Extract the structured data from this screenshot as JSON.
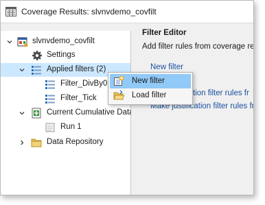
{
  "window": {
    "title": "Coverage Results: slvnvdemo_covfilt"
  },
  "tree": {
    "items": [
      {
        "label": "slvnvdemo_covfilt",
        "icon": "model-icon",
        "expanded": true
      },
      {
        "label": "Settings",
        "icon": "gear-icon"
      },
      {
        "label": "Applied filters (2)",
        "icon": "filter-list-icon",
        "expanded": true,
        "selected": true
      },
      {
        "label": "Filter_DivBy0",
        "icon": "filter-icon"
      },
      {
        "label": "Filter_Tick",
        "icon": "filter-icon"
      },
      {
        "label": "Current Cumulative Data",
        "icon": "cumulative-data-icon",
        "expanded": true
      },
      {
        "label": "Run 1",
        "icon": "run-icon"
      },
      {
        "label": "Data Repository",
        "icon": "folder-icon",
        "expanded": false
      }
    ]
  },
  "filter_editor": {
    "title": "Filter Editor",
    "description": "Add filter rules from coverage re",
    "links": {
      "new_filter": "New filter",
      "justification": "Add justification filter rules fr",
      "make_justification": "Make justification filter rules fr"
    }
  },
  "context_menu": {
    "items": [
      {
        "label": "New filter",
        "icon": "new-filter-icon",
        "hover": true
      },
      {
        "label": "Load filter",
        "icon": "open-folder-icon"
      }
    ]
  },
  "colors": {
    "selection": "#cce8ff",
    "menu_hover": "#91c9f7",
    "link": "#1a4fa0"
  }
}
